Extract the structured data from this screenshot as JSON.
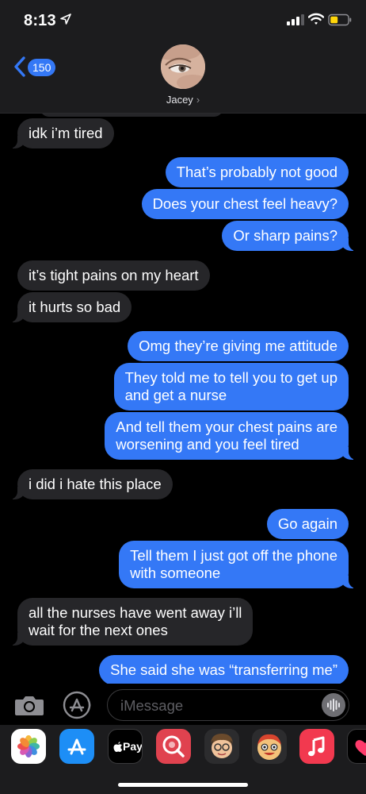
{
  "status_bar": {
    "time": "8:13"
  },
  "header": {
    "back_badge": "150",
    "contact_name": "Jacey",
    "chevron": "›"
  },
  "messages": [
    {
      "from": "them",
      "text": "idk i’m tired"
    },
    {
      "from": "me",
      "text": "That’s probably not good"
    },
    {
      "from": "me",
      "text": "Does your chest feel heavy?"
    },
    {
      "from": "me",
      "text": "Or sharp pains?"
    },
    {
      "from": "them",
      "text": "it’s tight pains on my heart"
    },
    {
      "from": "them",
      "text": "it hurts so bad"
    },
    {
      "from": "me",
      "text": "Omg they’re giving me attitude"
    },
    {
      "from": "me",
      "text": "They told me to tell you to get up\nand get a nurse"
    },
    {
      "from": "me",
      "text": "And tell them your chest pains are\nworsening and you feel tired"
    },
    {
      "from": "them",
      "text": "i did i hate this place"
    },
    {
      "from": "me",
      "text": "Go again"
    },
    {
      "from": "me",
      "text": "Tell them I just got off the phone\nwith someone"
    },
    {
      "from": "them",
      "text": "all the nurses have went away i’ll\nwait for the next ones"
    },
    {
      "from": "me",
      "text": "She said she was “transferring me”"
    }
  ],
  "input": {
    "placeholder": "iMessage"
  },
  "app_drawer": {
    "apple_pay_label": "Pay",
    "icons": [
      "photos-icon",
      "app-store-icon",
      "apple-pay-icon",
      "search-images-icon",
      "memoji-icon",
      "animoji-stickers-icon",
      "music-icon",
      "digital-touch-icon"
    ]
  },
  "colors": {
    "outgoing_bubble": "#3478f6",
    "incoming_bubble": "#262629",
    "background": "#000000",
    "bar_background": "#1c1c1e"
  }
}
